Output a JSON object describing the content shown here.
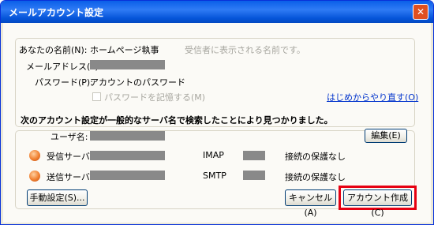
{
  "window": {
    "title": "メールアカウント設定",
    "close_label": "✕"
  },
  "account": {
    "name_label": "あなたの名前(N):",
    "name_value": "ホームページ執事",
    "name_hint": "受信者に表示される名前です。",
    "email_label": "メールアドレス(L):",
    "password_label": "パスワード(P):",
    "password_value": "アカウントのパスワード",
    "remember_label": "パスワードを記憶する(M)",
    "restart_link": "はじめからやり直す(O)"
  },
  "found": {
    "message": "次のアカウント設定が一般的なサーバ名で検索したことにより見つかりました。",
    "username_label": "ユーザ名:",
    "edit_button": "編集(E)",
    "incoming_label": "受信サーバ:",
    "incoming_protocol": "IMAP",
    "incoming_security": "接続の保護なし",
    "outgoing_label": "送信サーバ:",
    "outgoing_protocol": "SMTP",
    "outgoing_security": "接続の保護なし"
  },
  "buttons": {
    "manual": "手動設定(S)...",
    "cancel": "キャンセル(A)",
    "create": "アカウント作成(C)"
  },
  "colors": {
    "highlight": "#e60012",
    "title_bar": "#0a5fe8"
  }
}
